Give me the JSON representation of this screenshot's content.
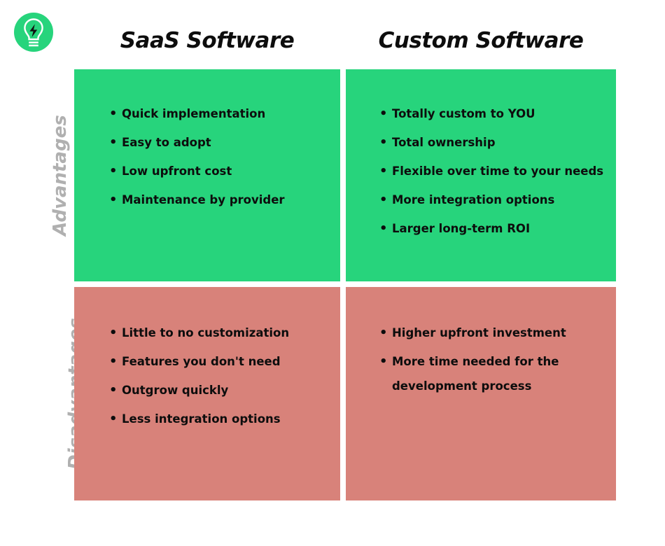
{
  "logo": {
    "name": "lightbulb-bolt-logo",
    "circle_color": "#27d47c",
    "bulb_color": "#ffffff",
    "bolt_color": "#111111"
  },
  "colors": {
    "advantages_bg": "#27d47c",
    "disadvantages_bg": "#d8827a",
    "heading_text": "#0d0d0d",
    "row_label_text": "#b0b0b0",
    "page_bg": "#ffffff"
  },
  "columns": [
    {
      "label": "SaaS Software"
    },
    {
      "label": "Custom Software"
    }
  ],
  "rows": [
    {
      "label": "Advantages"
    },
    {
      "label": "Disadvantages"
    }
  ],
  "bullet_glyph": "•",
  "cells": {
    "saas_advantages": [
      "Quick implementation",
      "Easy to adopt",
      "Low upfront cost",
      "Maintenance by provider"
    ],
    "custom_advantages": [
      "Totally custom to YOU",
      "Total ownership",
      "Flexible over time to your needs",
      "More integration options",
      "Larger long-term ROI"
    ],
    "saas_disadvantages": [
      "Little to no customization",
      "Features you don't need",
      "Outgrow quickly",
      "Less integration options"
    ],
    "custom_disadvantages": [
      "Higher upfront investment",
      "More time needed for the development process"
    ]
  }
}
